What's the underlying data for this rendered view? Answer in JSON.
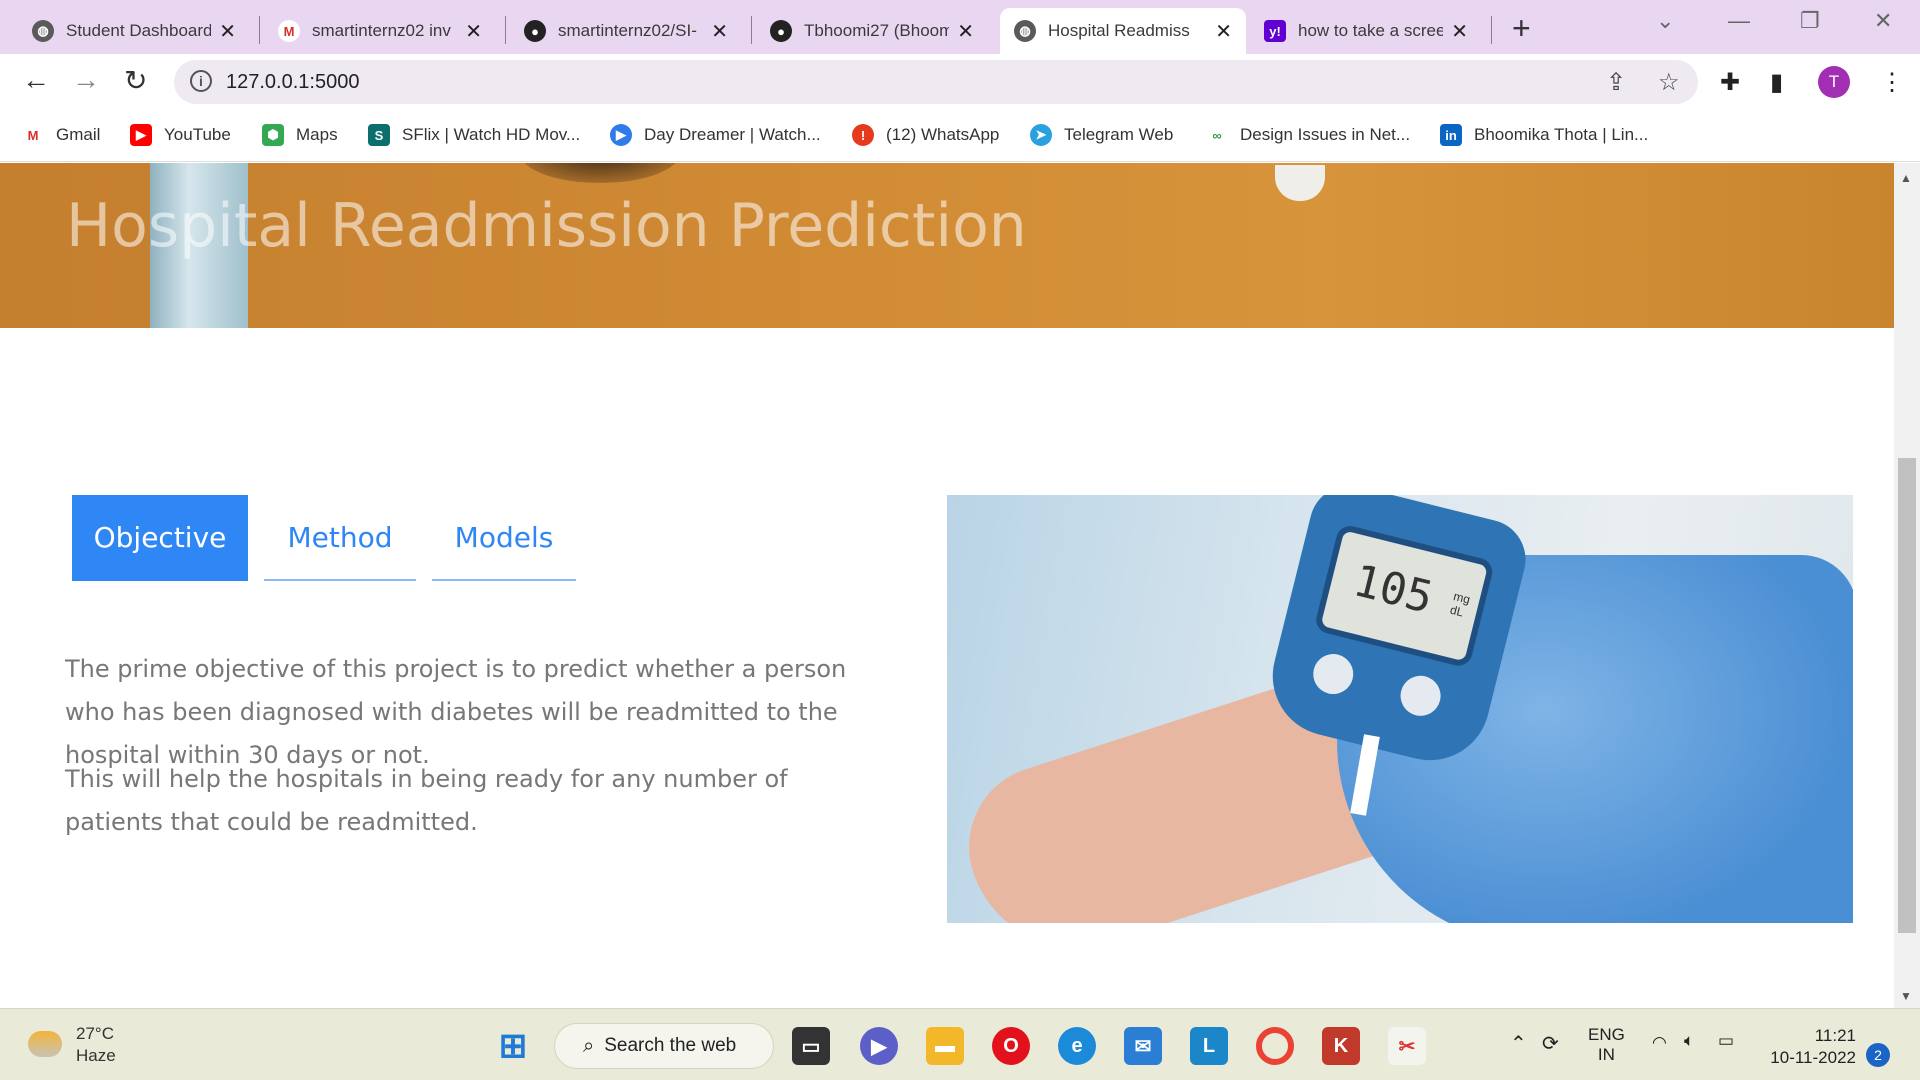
{
  "browser": {
    "tabs": [
      {
        "title": "Student Dashboard",
        "icon": "globe-icon",
        "color": "#555555"
      },
      {
        "title": "smartinternz02 inv",
        "icon": "gmail-icon",
        "color": "#d93025"
      },
      {
        "title": "smartinternz02/SI-",
        "icon": "github-icon",
        "color": "#222222"
      },
      {
        "title": "Tbhoomi27 (Bhoom",
        "icon": "github-icon",
        "color": "#222222"
      },
      {
        "title": "Hospital Readmiss",
        "icon": "globe-icon",
        "color": "#555555"
      },
      {
        "title": "how to take a scree",
        "icon": "yahoo-icon",
        "color": "#6001d2"
      }
    ],
    "url": "127.0.0.1:5000",
    "profile_initial": "T",
    "bookmarks": [
      {
        "label": "Gmail",
        "icon": "gmail-icon"
      },
      {
        "label": "YouTube",
        "icon": "youtube-icon"
      },
      {
        "label": "Maps",
        "icon": "maps-icon"
      },
      {
        "label": "SFlix | Watch HD Mov...",
        "icon": "sflix-icon"
      },
      {
        "label": "Day Dreamer | Watch...",
        "icon": "play-icon"
      },
      {
        "label": "(12) WhatsApp",
        "icon": "whatsapp-icon"
      },
      {
        "label": "Telegram Web",
        "icon": "telegram-icon"
      },
      {
        "label": "Design Issues in Net...",
        "icon": "link-icon"
      },
      {
        "label": "Bhoomika Thota | Lin...",
        "icon": "linkedin-icon"
      }
    ]
  },
  "page": {
    "hero_title": "Hospital Readmission Prediction",
    "tabs": [
      "Objective",
      "Method",
      "Models"
    ],
    "active_tab": "Objective",
    "paragraphs": [
      "The prime objective of this project is to predict whether a person who has been diagnosed with diabetes will be readmitted to the hospital within 30 days or not.",
      "This will help the hospitals in being ready for any number of patients that could be readmitted."
    ],
    "image": {
      "reading": "105",
      "unit": "mg dL",
      "accent": "#2f86f5"
    }
  },
  "taskbar": {
    "temperature": "27°C",
    "condition": "Haze",
    "search_placeholder": "Search the web",
    "language": "ENG",
    "region": "IN",
    "time": "11:21",
    "date": "10-11-2022",
    "notifications": "2"
  }
}
